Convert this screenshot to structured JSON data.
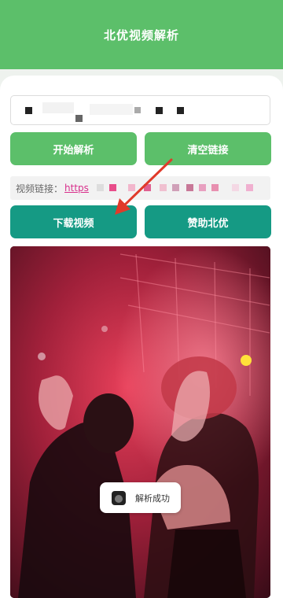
{
  "header": {
    "title": "北优视频解析"
  },
  "link_input": {
    "value": ""
  },
  "buttons": {
    "start": "开始解析",
    "clear": "清空链接",
    "download": "下载视频",
    "sponsor": "赞助北优"
  },
  "video_link": {
    "label": "视频链接：",
    "url": "https"
  },
  "toast": {
    "text": "解析成功",
    "icon": "app-icon"
  },
  "colors": {
    "header": "#5cbf6a",
    "green_button": "#5cbf6a",
    "teal_button": "#159a84",
    "link": "#d8308c",
    "annotation_arrow": "#e03a2a"
  }
}
